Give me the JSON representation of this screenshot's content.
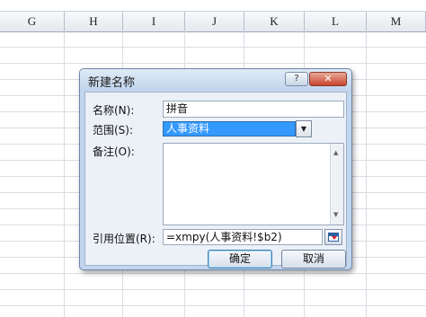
{
  "sheet": {
    "columns": [
      "G",
      "H",
      "I",
      "J",
      "K",
      "L",
      "M"
    ]
  },
  "dialog": {
    "title": "新建名称",
    "help_label": "?",
    "close_label": "✕",
    "name_label": "名称(N):",
    "name_value": "拼音",
    "scope_label": "范围(S):",
    "scope_value": "人事资料",
    "comment_label": "备注(O):",
    "comment_value": "",
    "ref_label": "引用位置(R):",
    "ref_value": "=xmpy(人事资料!$b2)",
    "ok_label": "确定",
    "cancel_label": "取消"
  }
}
